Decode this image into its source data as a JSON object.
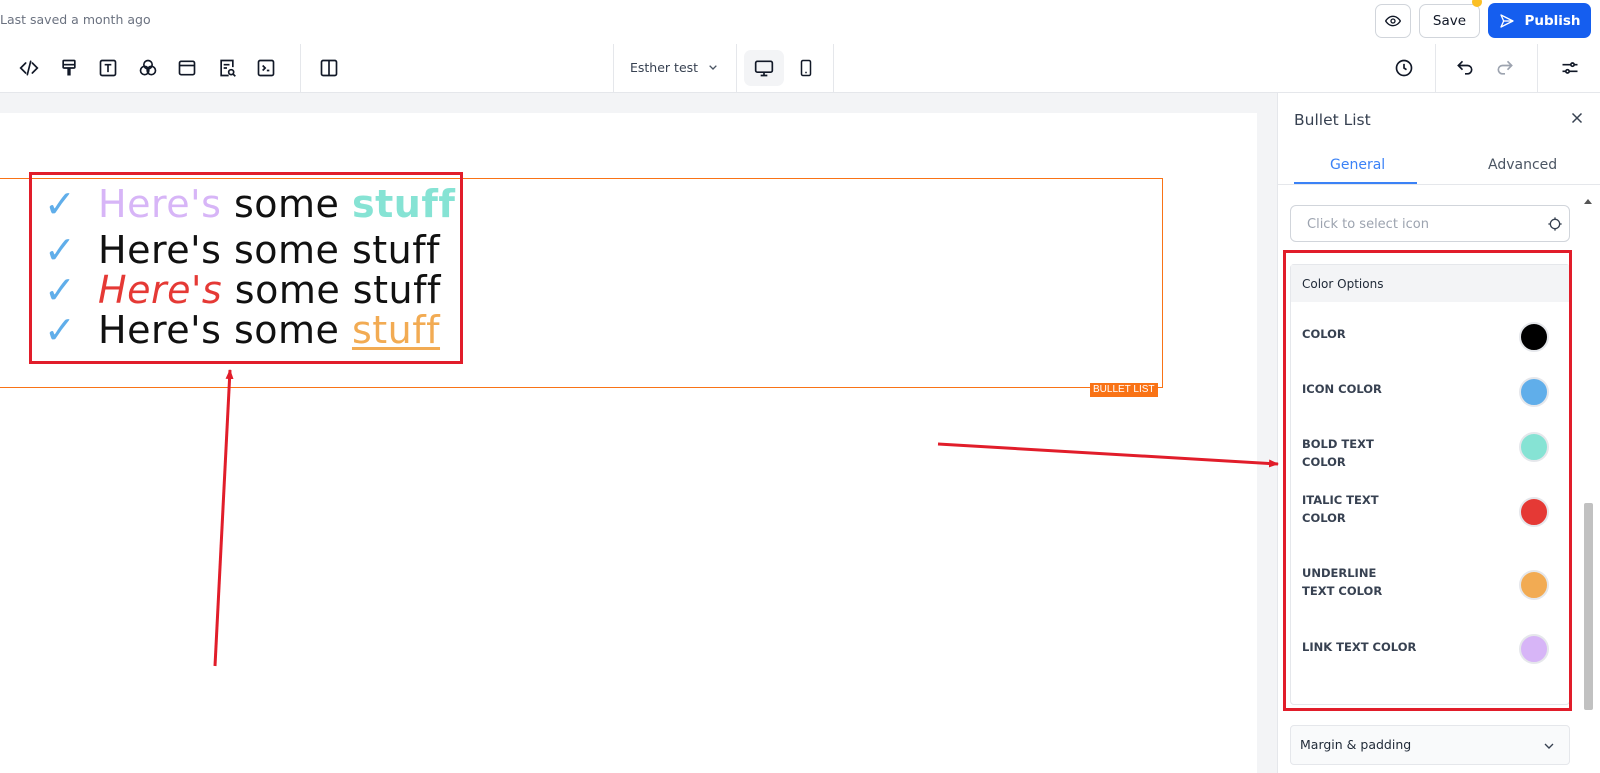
{
  "header": {
    "saved_text": "Last saved a month ago",
    "save_label": "Save",
    "publish_label": "Publish"
  },
  "toolbar": {
    "page_name": "Esther test"
  },
  "canvas": {
    "bullet_list": {
      "tag_label": "BULLET LIST",
      "check_glyph": "✓",
      "items": [
        {
          "parts": [
            "Here's",
            " some ",
            "stuff"
          ]
        },
        {
          "parts": [
            "Here's some stuff"
          ]
        },
        {
          "parts": [
            "Here's",
            " some stuff"
          ]
        },
        {
          "parts": [
            "Here's some ",
            "stuff"
          ]
        }
      ]
    }
  },
  "panel": {
    "title": "Bullet List",
    "tabs": {
      "general": "General",
      "advanced": "Advanced"
    },
    "icon_select_placeholder": "Click to select icon",
    "color_options": {
      "title": "Color Options",
      "items": [
        {
          "label": "COLOR",
          "color": "#000000"
        },
        {
          "label": "ICON COLOR",
          "color": "#60aeea"
        },
        {
          "label": "BOLD TEXT COLOR",
          "color": "#86e3d4"
        },
        {
          "label": "ITALIC TEXT COLOR",
          "color": "#e53935"
        },
        {
          "label": "UNDERLINE TEXT COLOR",
          "color": "#f2ab53"
        },
        {
          "label": "LINK TEXT COLOR",
          "color": "#d7b5f7"
        }
      ]
    },
    "margin_section": "Margin & padding"
  },
  "colors": {
    "accent": "#155eef",
    "highlight": "#e11d2a",
    "selection": "#f97316"
  }
}
